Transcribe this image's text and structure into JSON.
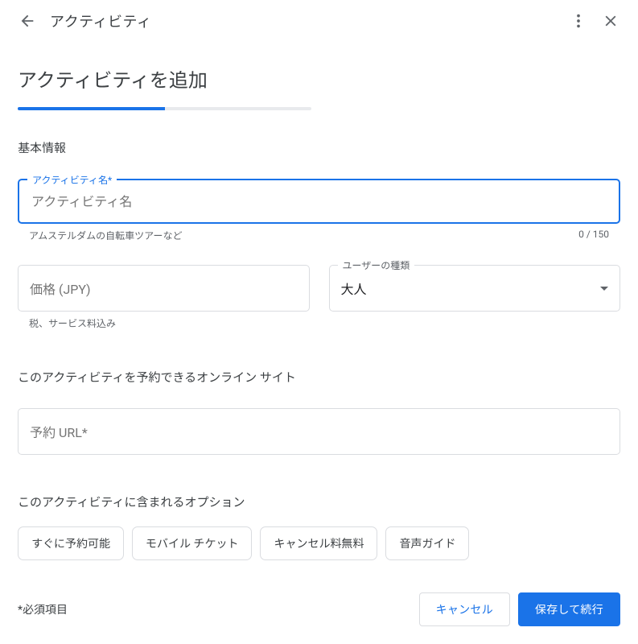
{
  "topbar": {
    "title": "アクティビティ"
  },
  "page": {
    "title": "アクティビティを追加",
    "progress_percent": 50
  },
  "sections": {
    "basic_info": "基本情報",
    "booking_site": "このアクティビティを予約できるオンライン サイト",
    "options": "このアクティビティに含まれるオプション"
  },
  "fields": {
    "activity_name": {
      "label": "アクティビティ名*",
      "placeholder": "アクティビティ名",
      "helper": "アムステルダムの自転車ツアーなど",
      "counter": "0 / 150",
      "value": ""
    },
    "price": {
      "label": "価格 (JPY)",
      "helper": "税、サービス料込み",
      "value": ""
    },
    "user_type": {
      "label": "ユーザーの種類",
      "value": "大人"
    },
    "booking_url": {
      "label": "予約 URL*",
      "value": ""
    }
  },
  "chips": [
    "すぐに予約可能",
    "モバイル チケット",
    "キャンセル料無料",
    "音声ガイド"
  ],
  "footer": {
    "required_note": "*必須項目",
    "cancel": "キャンセル",
    "save_continue": "保存して続行"
  }
}
